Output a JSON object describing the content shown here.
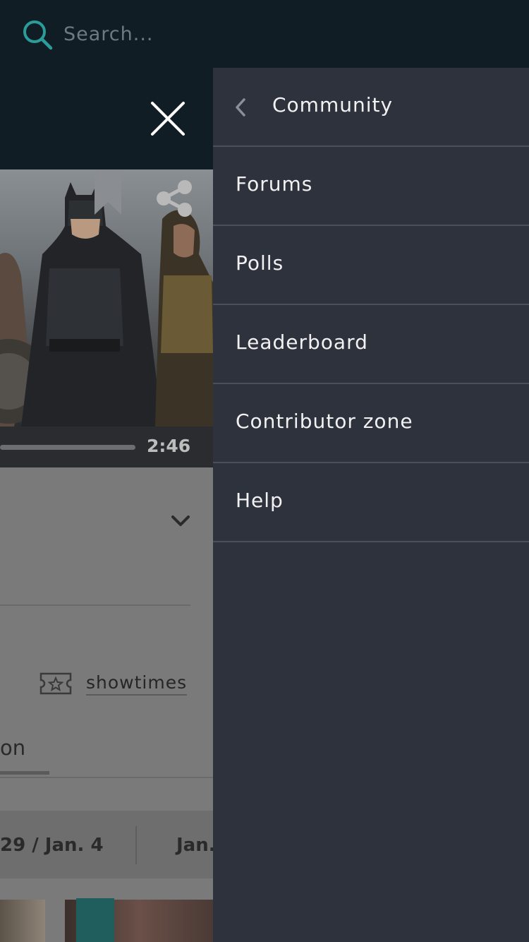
{
  "search": {
    "placeholder": "Search..."
  },
  "video": {
    "duration": "2:46"
  },
  "background": {
    "showtimes_label": "showtimes",
    "tab_partial": "on",
    "dates": [
      "29 / Jan. 4",
      "Jan."
    ]
  },
  "menu": {
    "header": "Community",
    "items": [
      {
        "label": "Forums"
      },
      {
        "label": "Polls"
      },
      {
        "label": "Leaderboard"
      },
      {
        "label": "Contributor zone"
      },
      {
        "label": "Help"
      }
    ]
  },
  "colors": {
    "accent": "#2a9d9a",
    "drawer_bg": "#2e323d",
    "topbar_bg": "#111d25"
  }
}
